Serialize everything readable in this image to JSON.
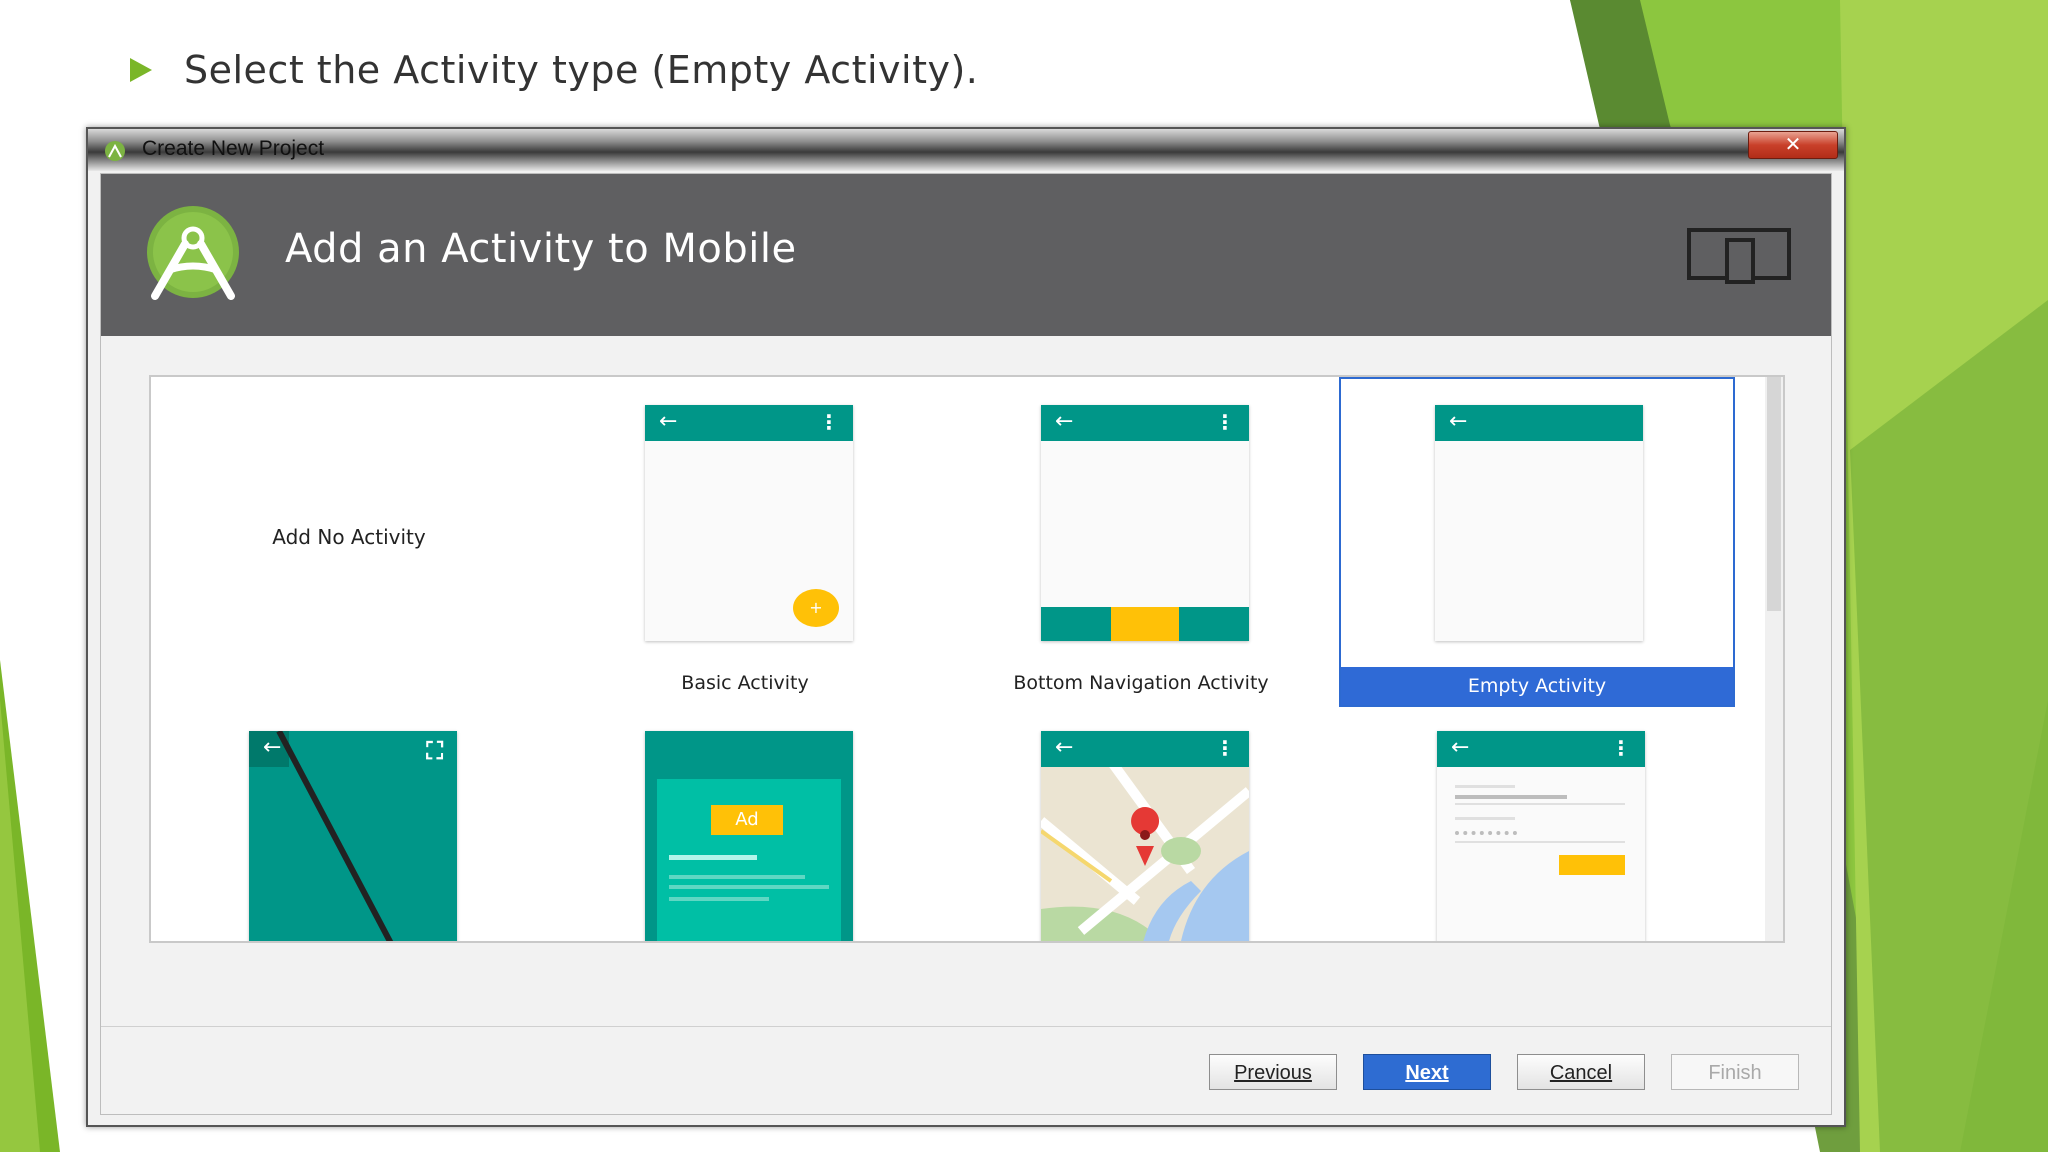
{
  "slide": {
    "bullet_text": "Select the Activity type (Empty Activity)."
  },
  "window": {
    "title": "Create New Project",
    "close_label": "✕"
  },
  "header": {
    "title": "Add an Activity to Mobile"
  },
  "gallery": {
    "tiles": [
      {
        "label": "Add No Activity",
        "kind": "none",
        "selected": false
      },
      {
        "label": "Basic Activity",
        "kind": "basic",
        "selected": false
      },
      {
        "label": "Bottom Navigation Activity",
        "kind": "bottom-nav",
        "selected": false
      },
      {
        "label": "Empty Activity",
        "kind": "empty",
        "selected": true
      }
    ],
    "second_row": [
      {
        "kind": "fullscreen"
      },
      {
        "kind": "ad",
        "ad_label": "Ad"
      },
      {
        "kind": "maps"
      },
      {
        "kind": "login"
      }
    ]
  },
  "buttons": {
    "previous": "Previous",
    "next": "Next",
    "cancel": "Cancel",
    "finish": "Finish"
  },
  "colors": {
    "teal": "#009688",
    "amber": "#ffc107",
    "selection_blue": "#2f6ad6",
    "header_gray": "#5f5f61",
    "slide_green": "#7ab628"
  }
}
